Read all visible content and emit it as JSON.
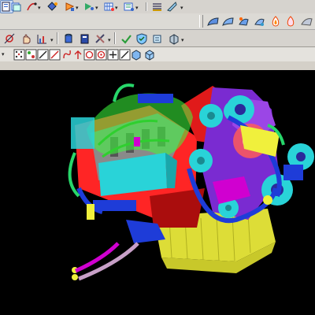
{
  "window": {
    "type": "CAD modeling application",
    "viewport_background": "#000000"
  },
  "toolbar_row_1": {
    "items": [
      "document-icon",
      "layers-icon",
      "curve-edit-icon",
      "dropdown-arrow-icon",
      "diamond-feature-icon",
      "arrow-feature-icon",
      "dropdown-arrow-icon",
      "play-sketch-icon",
      "dropdown-arrow-icon",
      "grid-feature-icon",
      "dropdown-arrow-icon",
      "lines-settings-icon",
      "ruler-icon",
      "dropdown-arrow-icon"
    ]
  },
  "toolbar_row_2": {
    "items": [
      "surface-blue-1-icon",
      "surface-blue-2-icon",
      "surface-blue-3-icon",
      "surface-blue-4-icon",
      "flame-surface-icon",
      "flame-outline-icon",
      "surface-gray-icon"
    ]
  },
  "toolbar_row_3": {
    "items": [
      "dimension-constraint-icon",
      "hand-select-icon",
      "chart-measure-icon",
      "dropdown-arrow-icon",
      "cylinder-part-icon",
      "book-manual-icon",
      "tools-assembly-icon",
      "dropdown-arrow-icon",
      "check-analysis-icon",
      "shield-analysis-icon",
      "stack-analysis-icon",
      "cube-section-icon",
      "dropdown-arrow-icon"
    ]
  },
  "toolbar_row_4": {
    "items": [
      "dropdown-arrow-icon",
      "dots-grid-icon",
      "color-point-icon",
      "line-icon",
      "diagonal-line-icon",
      "curve-icon",
      "arrow-up-icon",
      "circle-target-icon",
      "circle-dot-icon",
      "plus-icon",
      "slash-icon",
      "cube-view-icon",
      "box-view-icon"
    ]
  },
  "colors": {
    "toolbar_bg": "#d6d3ce",
    "accent_blue": "#2f63c9",
    "cyan": "#29d3d8",
    "green": "#3cff3c",
    "magenta": "#d000d0",
    "red": "#ff2020",
    "yellow": "#f0f03c",
    "purple": "#7a2bd1"
  }
}
